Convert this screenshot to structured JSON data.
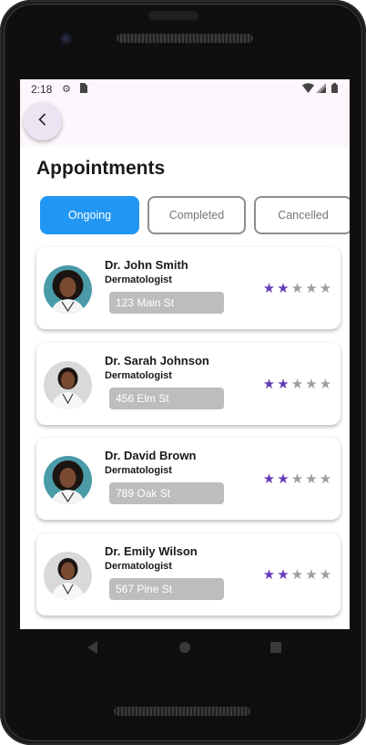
{
  "status": {
    "time": "2:18",
    "icons": [
      "gear-icon",
      "sim-card-icon",
      "wifi-icon",
      "signal-icon",
      "battery-icon"
    ]
  },
  "header": {
    "back_icon": "chevron-left-icon",
    "title": "Appointments"
  },
  "tabs": [
    {
      "label": "Ongoing",
      "active": true
    },
    {
      "label": "Completed",
      "active": false
    },
    {
      "label": "Cancelled",
      "active": false
    }
  ],
  "appointments": [
    {
      "name": "Dr. John Smith",
      "specialty": "Dermatologist",
      "address": "123 Main St",
      "rating": 2,
      "rating_max": 5
    },
    {
      "name": "Dr. Sarah Johnson",
      "specialty": "Dermatologist",
      "address": "456 Elm St",
      "rating": 2,
      "rating_max": 5
    },
    {
      "name": "Dr. David Brown",
      "specialty": "Dermatologist",
      "address": "789 Oak St",
      "rating": 2,
      "rating_max": 5
    },
    {
      "name": "Dr. Emily Wilson",
      "specialty": "Dermatologist",
      "address": "567 Pine St",
      "rating": 2,
      "rating_max": 5
    }
  ],
  "colors": {
    "accent": "#2196f3",
    "star_filled": "#673ab7",
    "star_empty": "#9e9e9e",
    "address_bg": "#bdbdbd",
    "appbar_bg": "#fdf7fd"
  },
  "nav_icons": [
    "back-triangle-icon",
    "home-circle-icon",
    "recents-square-icon"
  ]
}
